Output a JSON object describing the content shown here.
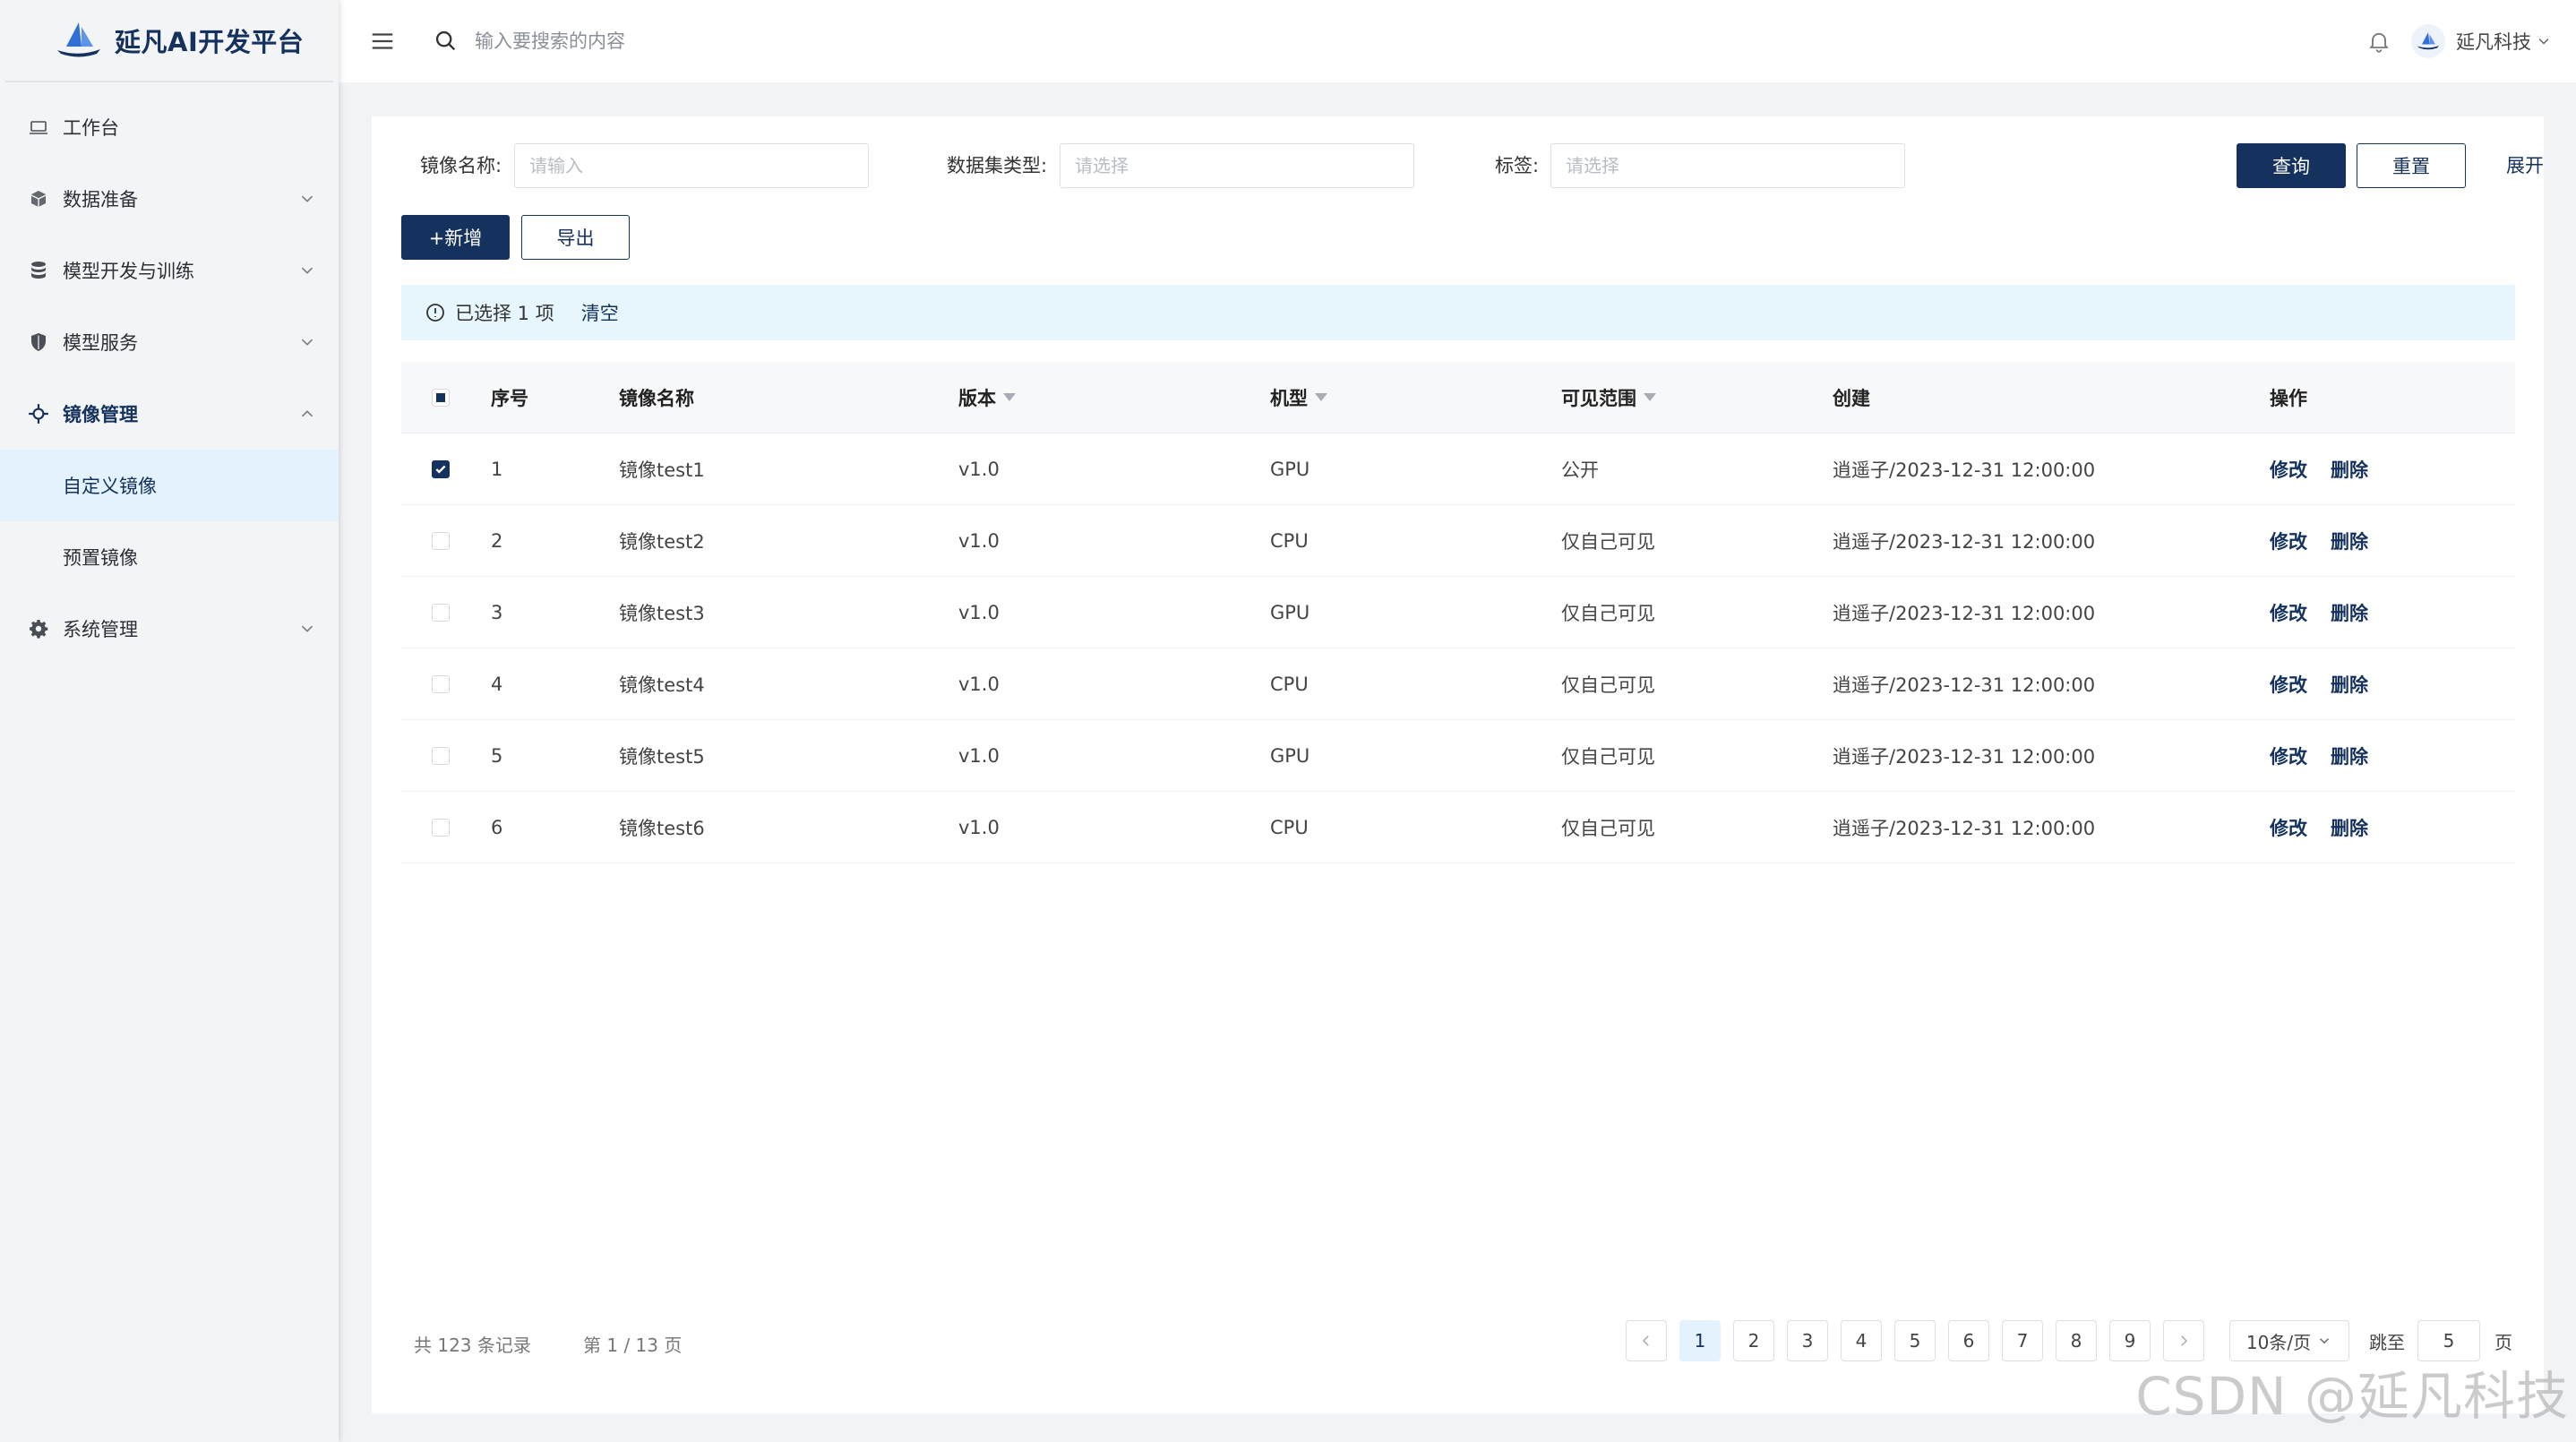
{
  "app": {
    "title": "延凡AI开发平台"
  },
  "sidebar": {
    "items": [
      {
        "label": "工作台",
        "icon": "laptop-icon",
        "expandable": false
      },
      {
        "label": "数据准备",
        "icon": "cube-icon",
        "expandable": true
      },
      {
        "label": "模型开发与训练",
        "icon": "database-icon",
        "expandable": true
      },
      {
        "label": "模型服务",
        "icon": "shield-icon",
        "expandable": true
      },
      {
        "label": "镜像管理",
        "icon": "crosshair-icon",
        "expandable": true,
        "open": true,
        "children": [
          {
            "label": "自定义镜像",
            "active": true
          },
          {
            "label": "预置镜像",
            "active": false
          }
        ]
      },
      {
        "label": "系统管理",
        "icon": "gear-icon",
        "expandable": true
      }
    ]
  },
  "header": {
    "search_placeholder": "输入要搜索的内容",
    "user_name": "延凡科技"
  },
  "filters": {
    "image_name_label": "镜像名称:",
    "image_name_placeholder": "请输入",
    "dataset_type_label": "数据集类型:",
    "dataset_type_placeholder": "请选择",
    "tag_label": "标签:",
    "tag_placeholder": "请选择",
    "query_label": "查询",
    "reset_label": "重置",
    "expand_label": "展开"
  },
  "toolbar": {
    "add_label": "+新增",
    "export_label": "导出"
  },
  "selection": {
    "text": "已选择 1 项",
    "clear_label": "清空"
  },
  "table": {
    "columns": [
      "序号",
      "镜像名称",
      "版本",
      "机型",
      "可见范围",
      "创建",
      "操作"
    ],
    "rows": [
      {
        "idx": "1",
        "name": "镜像test1",
        "version": "v1.0",
        "type": "GPU",
        "scope": "公开",
        "created": "逍遥子/2023-12-31 12:00:00",
        "checked": true
      },
      {
        "idx": "2",
        "name": "镜像test2",
        "version": "v1.0",
        "type": "CPU",
        "scope": "仅自己可见",
        "created": "逍遥子/2023-12-31 12:00:00",
        "checked": false
      },
      {
        "idx": "3",
        "name": "镜像test3",
        "version": "v1.0",
        "type": "GPU",
        "scope": "仅自己可见",
        "created": "逍遥子/2023-12-31 12:00:00",
        "checked": false
      },
      {
        "idx": "4",
        "name": "镜像test4",
        "version": "v1.0",
        "type": "CPU",
        "scope": "仅自己可见",
        "created": "逍遥子/2023-12-31 12:00:00",
        "checked": false
      },
      {
        "idx": "5",
        "name": "镜像test5",
        "version": "v1.0",
        "type": "GPU",
        "scope": "仅自己可见",
        "created": "逍遥子/2023-12-31 12:00:00",
        "checked": false
      },
      {
        "idx": "6",
        "name": "镜像test6",
        "version": "v1.0",
        "type": "CPU",
        "scope": "仅自己可见",
        "created": "逍遥子/2023-12-31 12:00:00",
        "checked": false
      }
    ],
    "edit_label": "修改",
    "delete_label": "删除"
  },
  "pagination": {
    "total_text": "共 123 条记录",
    "page_text": "第 1 / 13 页",
    "pages": [
      "1",
      "2",
      "3",
      "4",
      "5",
      "6",
      "7",
      "8",
      "9"
    ],
    "current": "1",
    "page_size": "10条/页",
    "jump_label": "跳至",
    "jump_value": "5",
    "jump_suffix": "页"
  },
  "watermark": "CSDN @延凡科技",
  "colors": {
    "primary": "#14325d",
    "active_bg": "#e3f2fc",
    "alert_bg": "#e6f6fc"
  }
}
